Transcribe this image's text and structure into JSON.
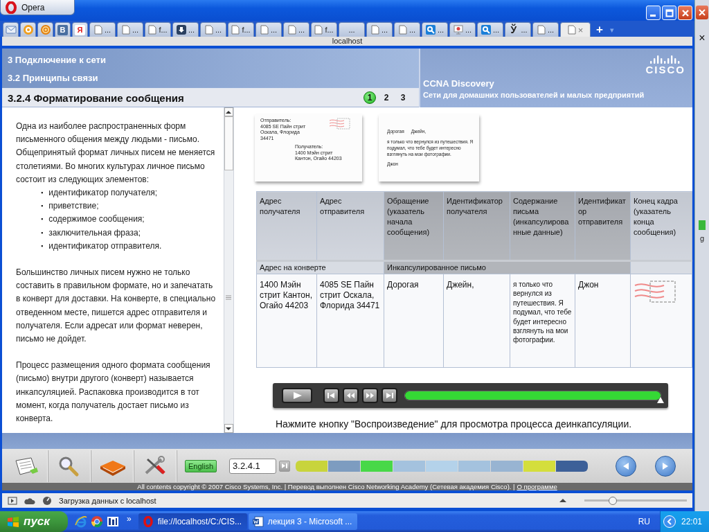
{
  "browser": {
    "title": "Opera",
    "tabs": [
      {
        "kind": "mail",
        "selected": false
      },
      {
        "kind": "opera-mail",
        "selected": false
      },
      {
        "kind": "at",
        "selected": false
      },
      {
        "kind": "vk",
        "glyph": "В",
        "selected": false
      },
      {
        "kind": "yandex",
        "glyph": "Я",
        "selected": false
      },
      {
        "kind": "page",
        "label": "...",
        "selected": false
      },
      {
        "kind": "page",
        "label": "...",
        "selected": false
      },
      {
        "kind": "page",
        "label": "f...",
        "selected": false
      },
      {
        "kind": "download",
        "label": "...",
        "selected": false
      },
      {
        "kind": "page",
        "label": "...",
        "selected": false
      },
      {
        "kind": "page",
        "label": "f...",
        "selected": false
      },
      {
        "kind": "page",
        "label": "...",
        "selected": false
      },
      {
        "kind": "page",
        "label": "...",
        "selected": false
      },
      {
        "kind": "page",
        "label": "f...",
        "selected": false
      },
      {
        "kind": "none",
        "label": "...",
        "selected": false
      },
      {
        "kind": "page",
        "label": "...",
        "selected": false
      },
      {
        "kind": "page",
        "label": "...",
        "selected": false
      },
      {
        "kind": "search",
        "label": "...",
        "selected": false
      },
      {
        "kind": "slides",
        "label": "...",
        "selected": false
      },
      {
        "kind": "search",
        "label": "...",
        "selected": false
      },
      {
        "kind": "glyph",
        "glyph": "Ў",
        "label": "...",
        "selected": false
      },
      {
        "kind": "page",
        "label": "...",
        "selected": false
      },
      {
        "kind": "page",
        "close": "×",
        "selected": true
      }
    ],
    "new_tab": "+",
    "tab_menu": "▾",
    "address": "localhost"
  },
  "side_window": {
    "close": "×",
    "tab_label": "g"
  },
  "header": {
    "chapter": "3 Подключение к сети",
    "section": "3.2 Принципы связи",
    "topic": "3.2.4 Форматирование сообщения",
    "pages": [
      {
        "label": "1",
        "selected": true
      },
      {
        "label": "2",
        "selected": false
      },
      {
        "label": "3",
        "selected": false
      }
    ],
    "logo": "CISCO",
    "course": "CCNA Discovery",
    "course_subtitle": "Сети для домашних пользователей и малых предприятий"
  },
  "lesson": [
    {
      "kind": "text",
      "text": "Одна из наиболее распространенных форм письменного общения между людьми - письмо. Общепринятый формат личных писем не меняется столетиями. Во многих культурах личное письмо состоит из следующих элементов:"
    },
    {
      "kind": "list",
      "items": [
        {
          "marker": "▪",
          "text": "идентификатор получателя;"
        },
        {
          "marker": "▪",
          "text": "приветствие;"
        },
        {
          "marker": "▪",
          "text": "содержимое сообщения;"
        },
        {
          "marker": "▪",
          "text": "заключительная фраза;"
        },
        {
          "marker": "▪",
          "text": "идентификатор отправителя."
        }
      ]
    },
    {
      "kind": "text",
      "text": "Большинство личных писем нужно не только составить в правильном формате, но и запечатать в конверт для доставки. На конверте, в специально отведенном месте, пишется адрес отправителя и получателя. Если адресат или формат неверен, письмо не дойдет."
    },
    {
      "kind": "text",
      "text": "Процесс размещения одного формата сообщения (письмо) внутри другого (конверт) называется инкапсуляцией. Распаковка производится в тот момент, когда получатель достает письмо из конверта."
    }
  ],
  "envelope": {
    "sender": "Отправитель:\n4085 SE Пайн стрит\nОскала, Флорида\n34471",
    "recipient": "Получатель:\n1400 Мэйн стрит\nКантон, Огайо 44203"
  },
  "letter": {
    "greeting": "Дорогая",
    "name": "Джейн,",
    "body": "я только что вернулся из путешествия. Я подумал, что тебе будет интересно взглянуть на мои фотографии.",
    "signature": "Джон"
  },
  "table": {
    "groups": [
      {
        "label": "Адрес на конверте",
        "kind": "light",
        "columns": [
          {
            "label": "Адрес получателя",
            "kind": "light",
            "cell": {
              "kind": "text",
              "text": "1400 Мэйн стрит Кантон, Огайо 44203"
            }
          },
          {
            "label": "Адрес отправителя",
            "kind": "light",
            "cell": {
              "kind": "text",
              "text": "4085 SE Пайн стрит Оскала, Флорида 34471"
            }
          }
        ]
      },
      {
        "label": "Инкапсулированное письмо",
        "kind": "dark",
        "columns": [
          {
            "label": "Обращение (указатель начала сообщения)",
            "kind": "dark",
            "cell": {
              "kind": "text",
              "text": "Дорогая"
            }
          },
          {
            "label": "Идентификатор получателя",
            "kind": "dark",
            "cell": {
              "kind": "text",
              "text": "Джейн,"
            }
          },
          {
            "label": "Содержание письма (инкапсулированные данные)",
            "kind": "dark",
            "cell": {
              "kind": "small",
              "text": "я только что вернулся из путешествия. Я подумал, что тебе будет интересно взглянуть на мои фотографии."
            }
          },
          {
            "label": "Идентификатор отправителя",
            "kind": "dark",
            "cell": {
              "kind": "text",
              "text": "Джон"
            }
          }
        ]
      },
      {
        "kind": "light",
        "columns": [
          {
            "label": "Конец кадра (указатель конца сообщения)",
            "kind": "light",
            "cell": {
              "kind": "stamp"
            }
          }
        ]
      }
    ]
  },
  "player": {
    "progress": {
      "level": 1
    }
  },
  "caption": "Нажмите кнопку \"Воспроизведение\" для просмотра процесса деинкапсуляции.",
  "toolbar": {
    "language": "English",
    "page": "3.2.4.1",
    "segments": [
      {
        "color": "#c8d43c"
      },
      {
        "color": "#7d9cc0"
      },
      {
        "color": "#48d848"
      },
      {
        "color": "#a4c2de"
      },
      {
        "color": "#b4d2ea"
      },
      {
        "color": "#a4c2de"
      },
      {
        "color": "#98b4d2"
      },
      {
        "color": "#d4de3c"
      },
      {
        "color": "#3d6098"
      }
    ]
  },
  "copyright": "All contents copyright © 2007 Cisco Systems, Inc. | Перевод выполнен Cisco Networking Academy (Сетевая академия Cisco). |",
  "about_link": "О программе",
  "status": {
    "text": "Загрузка данных с localhost",
    "zoom": {
      "level": 0.28
    }
  },
  "taskbar": {
    "start": "пуск",
    "more": "»",
    "tasks": [
      {
        "kind": "opera",
        "label": "file://localhost/C:/CIS...",
        "selected": true
      },
      {
        "kind": "word",
        "label": "лекция 3 - Microsoft ...",
        "selected": false
      }
    ],
    "language": "RU",
    "clock": "22:01"
  }
}
